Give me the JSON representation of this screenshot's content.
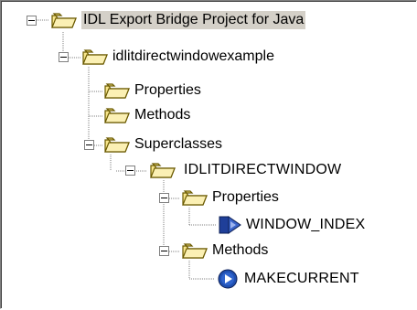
{
  "tree": {
    "root_label": "IDL Export Bridge Project for Java",
    "example_label": "idlitdirectwindowexample",
    "properties_label": "Properties",
    "methods_label": "Methods",
    "superclasses_label": "Superclasses",
    "superclass_label": "IDLITDIRECTWINDOW",
    "sc_properties_label": "Properties",
    "sc_property_item": "WINDOW_INDEX",
    "sc_methods_label": "Methods",
    "sc_method_item": "MAKECURRENT"
  },
  "icons": {
    "folder": "open-folder-icon",
    "property": "property-icon",
    "method": "method-icon"
  },
  "colors": {
    "folder_fill": "#f7e58a",
    "folder_stroke": "#6b5a00",
    "selection": "#d4d0c8",
    "property_blue": "#1f3f99",
    "method_blue": "#1f4fb0"
  }
}
